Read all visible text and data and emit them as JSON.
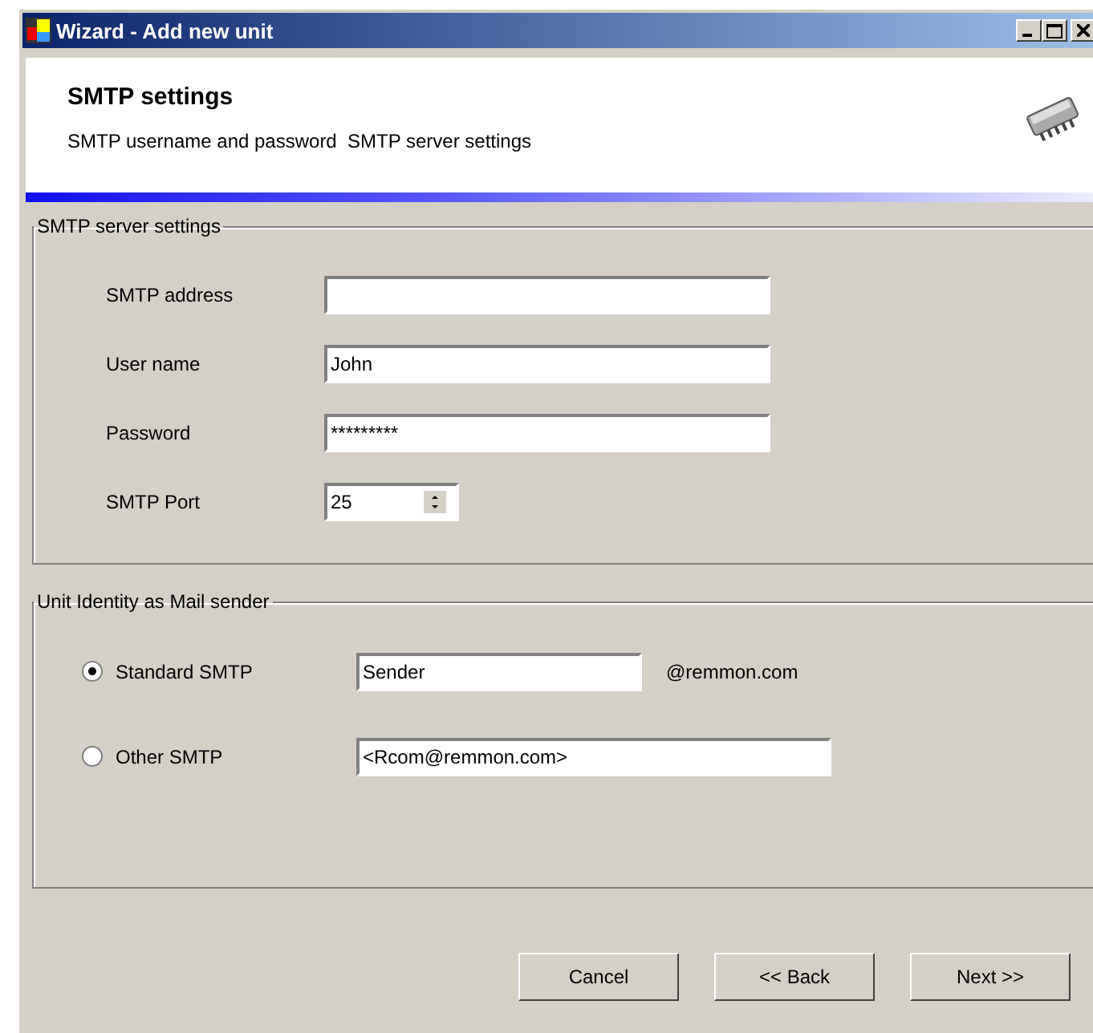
{
  "window": {
    "title": "Wizard - Add new unit"
  },
  "header": {
    "title": "SMTP settings",
    "subtitle": "SMTP username and password  SMTP server settings"
  },
  "server_group": {
    "title": "SMTP server settings",
    "fields": [
      {
        "label": "SMTP address",
        "kind": "text"
      },
      {
        "label": "User name",
        "value": "John",
        "kind": "text"
      },
      {
        "label": "Password",
        "value": "*********",
        "kind": "text"
      },
      {
        "label": "SMTP Port",
        "value": "25",
        "kind": "spinner"
      }
    ]
  },
  "identity_group": {
    "title": "Unit Identity as Mail sender",
    "options": [
      {
        "label": "Standard SMTP",
        "selected": true,
        "value": "Sender",
        "suffix": "@remmon.com"
      },
      {
        "label": "Other SMTP",
        "selected": false,
        "value": "<Rcom@remmon.com>"
      }
    ]
  },
  "buttons": [
    "Cancel",
    "<< Back",
    "Next >>"
  ]
}
